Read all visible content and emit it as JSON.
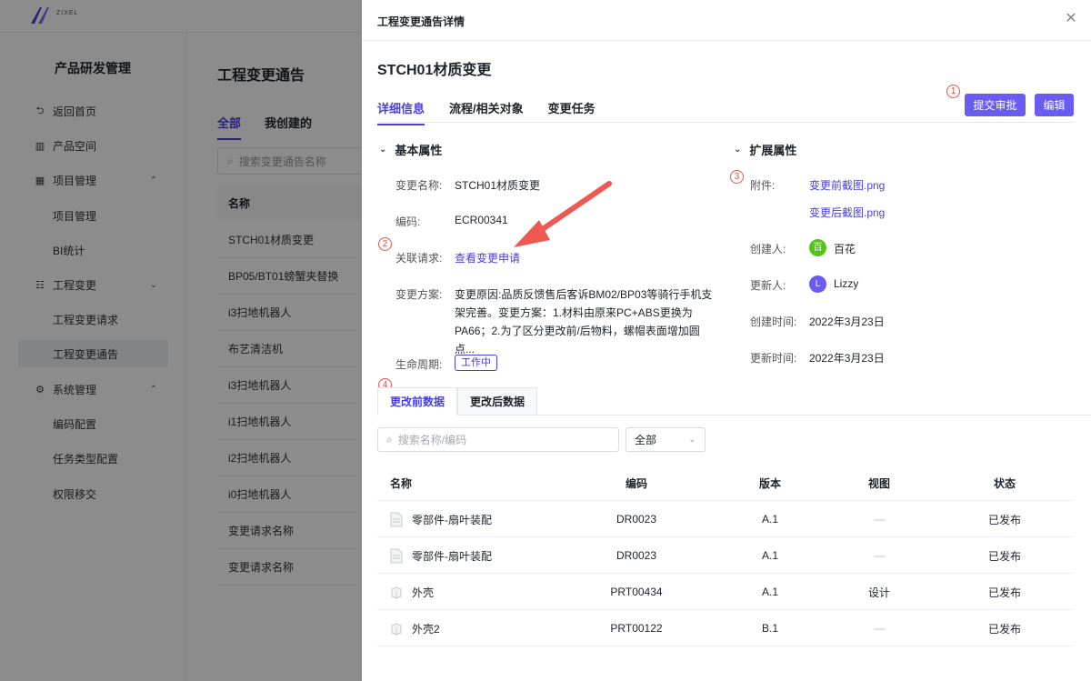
{
  "brand": {
    "logo_text": "ZIXEL",
    "accent": "#4a41d8",
    "button": "#6a5cf0"
  },
  "sidebar": {
    "title": "产品研发管理",
    "items": [
      {
        "label": "返回首页",
        "icon": "back-icon"
      },
      {
        "label": "产品空间",
        "icon": "product-space-icon"
      },
      {
        "label": "项目管理",
        "icon": "grid-icon",
        "expanded": true
      },
      {
        "label": "项目管理",
        "sub": true
      },
      {
        "label": "BI统计",
        "sub": true
      },
      {
        "label": "工程变更",
        "icon": "list-icon",
        "expanded": true
      },
      {
        "label": "工程变更请求",
        "sub": true
      },
      {
        "label": "工程变更通告",
        "sub": true,
        "active": true
      },
      {
        "label": "系统管理",
        "icon": "gear-icon",
        "expanded": true
      },
      {
        "label": "编码配置",
        "sub": true
      },
      {
        "label": "任务类型配置",
        "sub": true
      },
      {
        "label": "权限移交",
        "sub": true
      }
    ]
  },
  "content": {
    "title": "工程变更通告",
    "tabs": [
      "全部",
      "我创建的"
    ],
    "search_placeholder": "搜索变更通告名称",
    "list_header": "名称",
    "rows": [
      "STCH01材质变更",
      "BP05/BT01螃蟹夹替换",
      "i3扫地机器人",
      "布艺清洁机",
      "i3扫地机器人",
      "i1扫地机器人",
      "i2扫地机器人",
      "i0扫地机器人",
      "变更请求名称",
      "变更请求名称"
    ]
  },
  "drawer": {
    "title": "工程变更通告详情",
    "record_title": "STCH01材质变更",
    "tabs": [
      "详细信息",
      "流程/相关对象",
      "变更任务"
    ],
    "submit_label": "提交审批",
    "edit_label": "编辑",
    "markers": [
      "1",
      "2",
      "3",
      "4"
    ],
    "basic": {
      "heading": "基本属性",
      "name_label": "变更名称:",
      "name_value": "STCH01材质变更",
      "code_label": "编码:",
      "code_value": "ECR00341",
      "request_label": "关联请求:",
      "request_link": "查看变更申请",
      "plan_label": "变更方案:",
      "plan_value": "变更原因:品质反馈售后客诉BM02/BP03等骑行手机支架完善。变更方案：1.材料由原来PC+ABS更换为PA66；2.为了区分更改前/后物料，螺帽表面增加圆点...",
      "lifecycle_label": "生命周期:",
      "lifecycle_value": "工作中"
    },
    "extended": {
      "heading": "扩展属性",
      "attachment_label": "附件:",
      "attachments": [
        "变更前截图.png",
        "变更后截图.png"
      ],
      "creator_label": "创建人:",
      "creator_avatar": "百",
      "creator_name": "百花",
      "creator_color": "#52c41a",
      "updater_label": "更新人:",
      "updater_avatar": "L",
      "updater_name": "Lizzy",
      "updater_color": "#6a5cf0",
      "created_label": "创建时间:",
      "created_value": "2022年3月23日",
      "updated_label": "更新时间:",
      "updated_value": "2022年3月23日"
    },
    "data_tabs": [
      "更改前数据",
      "更改后数据"
    ],
    "search_placeholder": "搜索名称/编码",
    "filter_value": "全部",
    "table": {
      "headers": [
        "名称",
        "编码",
        "版本",
        "视图",
        "状态"
      ],
      "rows": [
        {
          "icon": "document-icon",
          "name": "零部件-扇叶装配",
          "code": "DR0023",
          "version": "A.1",
          "view": "—",
          "status": "已发布"
        },
        {
          "icon": "document-icon",
          "name": "零部件-扇叶装配",
          "code": "DR0023",
          "version": "A.1",
          "view": "—",
          "status": "已发布"
        },
        {
          "icon": "box-icon",
          "name": "外壳",
          "code": "PRT00434",
          "version": "A.1",
          "view": "设计",
          "status": "已发布"
        },
        {
          "icon": "box-icon",
          "name": "外壳2",
          "code": "PRT00122",
          "version": "B.1",
          "view": "—",
          "status": "已发布"
        }
      ]
    }
  }
}
